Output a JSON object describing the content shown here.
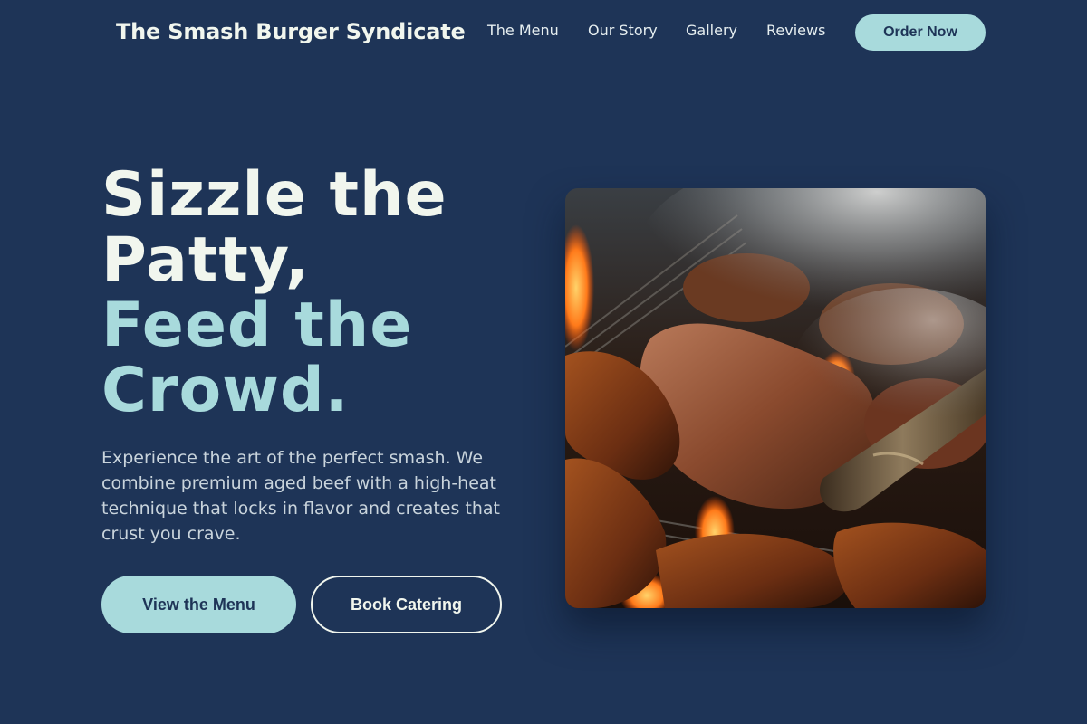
{
  "header": {
    "brand": "The Smash Burger Syndicate",
    "nav": [
      "The Menu",
      "Our Story",
      "Gallery",
      "Reviews"
    ],
    "order_label": "Order Now"
  },
  "hero": {
    "headline_line1": "Sizzle the",
    "headline_line2": "Patty,",
    "headline_line3": "Feed the",
    "headline_line4": "Crowd.",
    "description": "Experience the art of the perfect smash. We combine premium aged beef with a high-heat technique that locks in flavor and creates that crust you crave.",
    "primary_button": "View the Menu",
    "secondary_button": "Book Catering",
    "image_icon": "grilled-meat-photo"
  },
  "colors": {
    "background": "#1e3457",
    "accent": "#a8dadc",
    "text_light": "#f1f6ee",
    "text_muted": "#c9d4dc"
  }
}
